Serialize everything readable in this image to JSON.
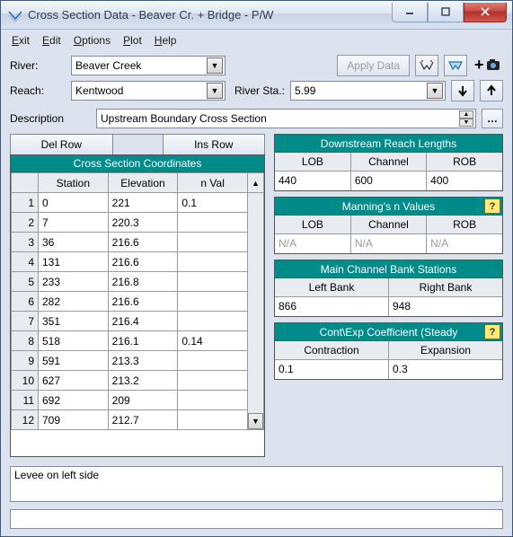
{
  "window": {
    "title": "Cross Section Data - Beaver Cr. + Bridge - P/W"
  },
  "menubar": {
    "exit": "Exit",
    "edit": "Edit",
    "options": "Options",
    "plot": "Plot",
    "help": "Help"
  },
  "river": {
    "label": "River:",
    "value": "Beaver Creek"
  },
  "apply_data": "Apply Data",
  "reach": {
    "label": "Reach:",
    "value": "Kentwood"
  },
  "riversta": {
    "label": "River Sta.:",
    "value": "5.99"
  },
  "description": {
    "label": "Description",
    "value": "Upstream Boundary Cross Section"
  },
  "buttons": {
    "del_row": "Del Row",
    "ins_row": "Ins Row"
  },
  "coords": {
    "title": "Cross Section Coordinates",
    "headers": {
      "station": "Station",
      "elevation": "Elevation",
      "nval": "n Val"
    },
    "rows": [
      {
        "n": 1,
        "station": "0",
        "elevation": "221",
        "nval": "0.1"
      },
      {
        "n": 2,
        "station": "7",
        "elevation": "220.3",
        "nval": ""
      },
      {
        "n": 3,
        "station": "36",
        "elevation": "216.6",
        "nval": ""
      },
      {
        "n": 4,
        "station": "131",
        "elevation": "216.6",
        "nval": ""
      },
      {
        "n": 5,
        "station": "233",
        "elevation": "216.8",
        "nval": ""
      },
      {
        "n": 6,
        "station": "282",
        "elevation": "216.6",
        "nval": ""
      },
      {
        "n": 7,
        "station": "351",
        "elevation": "216.4",
        "nval": ""
      },
      {
        "n": 8,
        "station": "518",
        "elevation": "216.1",
        "nval": "0.14"
      },
      {
        "n": 9,
        "station": "591",
        "elevation": "213.3",
        "nval": ""
      },
      {
        "n": 10,
        "station": "627",
        "elevation": "213.2",
        "nval": ""
      },
      {
        "n": 11,
        "station": "692",
        "elevation": "209",
        "nval": ""
      },
      {
        "n": 12,
        "station": "709",
        "elevation": "212.7",
        "nval": ""
      }
    ]
  },
  "downstream": {
    "title": "Downstream Reach Lengths",
    "headers": {
      "lob": "LOB",
      "channel": "Channel",
      "rob": "ROB"
    },
    "values": {
      "lob": "440",
      "channel": "600",
      "rob": "400"
    }
  },
  "manning": {
    "title": "Manning's n Values",
    "headers": {
      "lob": "LOB",
      "channel": "Channel",
      "rob": "ROB"
    },
    "values": {
      "lob": "N/A",
      "channel": "N/A",
      "rob": "N/A"
    }
  },
  "banks": {
    "title": "Main Channel Bank Stations",
    "headers": {
      "left": "Left Bank",
      "right": "Right Bank"
    },
    "values": {
      "left": "866",
      "right": "948"
    }
  },
  "contexp": {
    "title": "Cont\\Exp Coefficient (Steady",
    "headers": {
      "contraction": "Contraction",
      "expansion": "Expansion"
    },
    "values": {
      "contraction": "0.1",
      "expansion": "0.3"
    }
  },
  "notes": "Levee on left side",
  "help_glyph": "?"
}
